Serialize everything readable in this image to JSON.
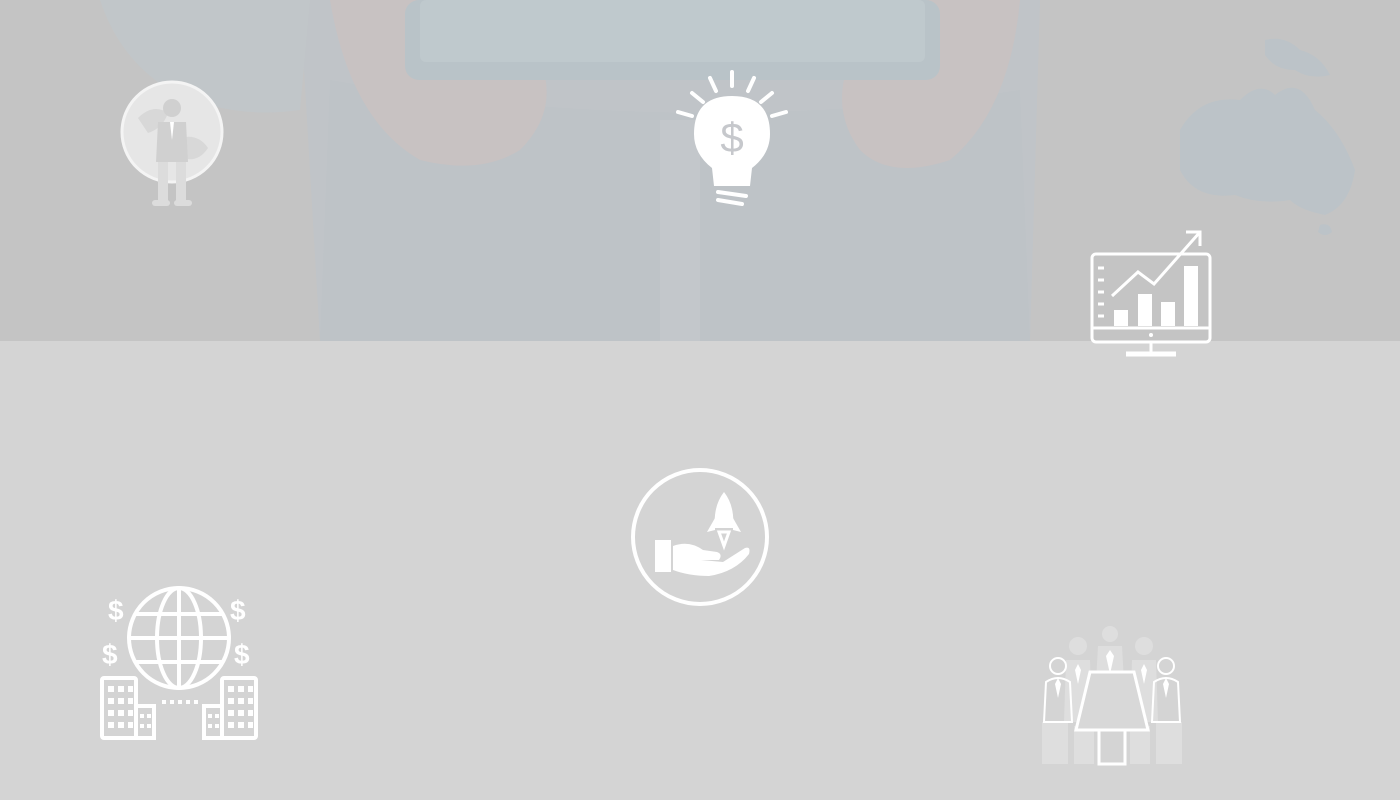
{
  "colors": {
    "hero_overlay": "#c6c6c6",
    "lower_background": "#d4d4d4",
    "icon_stroke": "#ffffff"
  },
  "hero": {
    "background_image": "businessman-holding-tablet-with-world-map"
  },
  "icons": [
    {
      "name": "businessman-globe-icon"
    },
    {
      "name": "lightbulb-dollar-icon"
    },
    {
      "name": "growth-chart-monitor-icon"
    },
    {
      "name": "hand-rocket-launch-icon"
    },
    {
      "name": "global-finance-buildings-icon"
    },
    {
      "name": "business-meeting-icon"
    }
  ]
}
